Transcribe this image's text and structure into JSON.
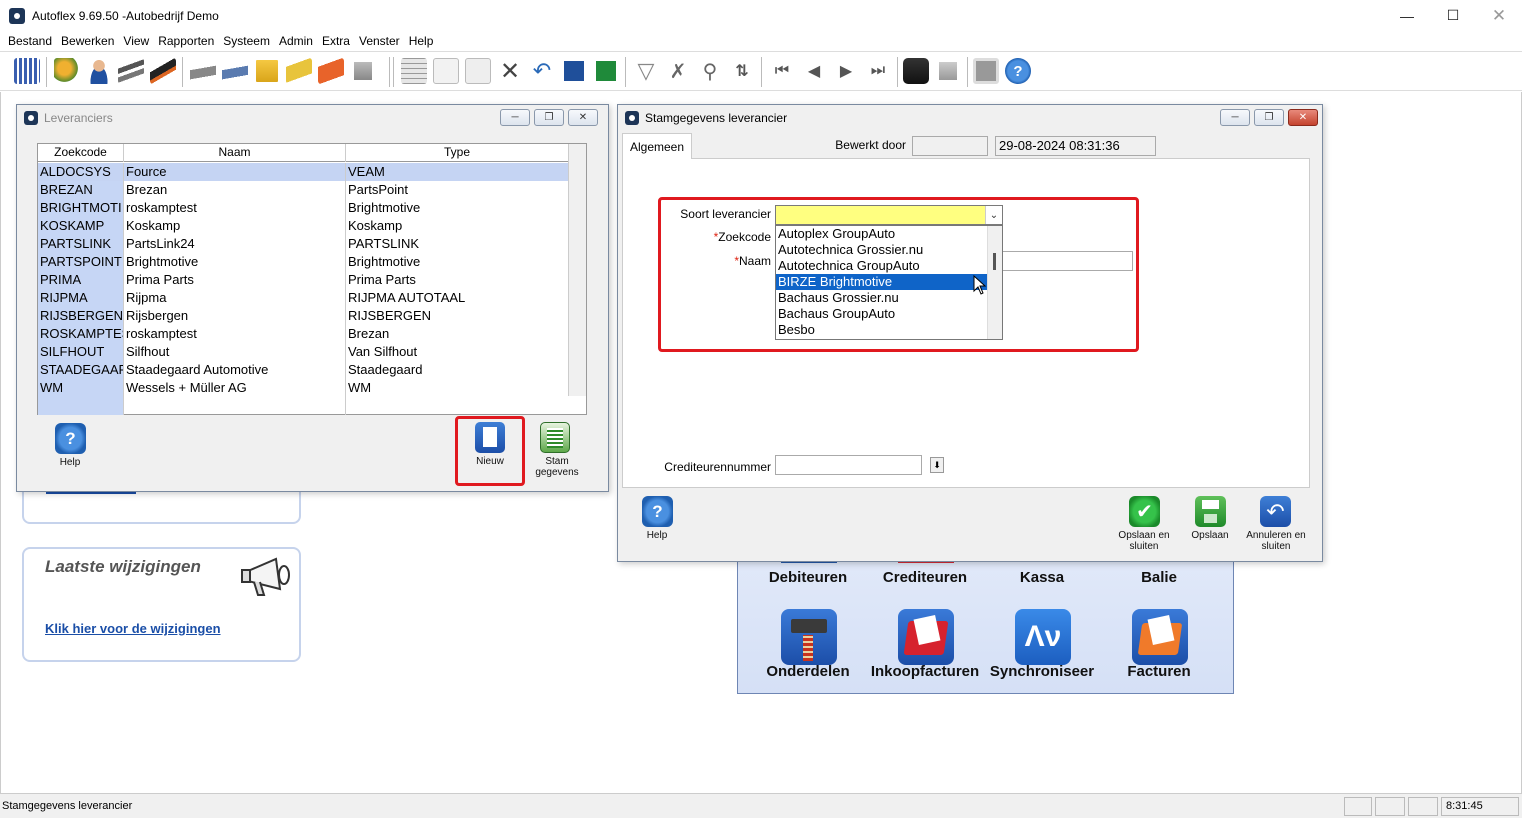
{
  "app": {
    "title": "Autoflex 9.69.50 -Autobedrijf Demo"
  },
  "menu": [
    "Bestand",
    "Bewerken",
    "View",
    "Rapporten",
    "Systeem",
    "Admin",
    "Extra",
    "Venster",
    "Help"
  ],
  "panels": {
    "laatste_title": "Laatste wijzigingen",
    "laatste_link": "Klik hier voor de wijzigingen"
  },
  "dashboard": {
    "labels": [
      "Debiteuren",
      "Crediteuren",
      "Kassa",
      "Balie",
      "Onderdelen",
      "Inkoopfacturen",
      "Synchroniseer",
      "Facturen"
    ]
  },
  "leveranciers": {
    "title": "Leveranciers",
    "columns": [
      "Zoekcode",
      "Naam",
      "Type"
    ],
    "rows": [
      [
        "ALDOCSYS",
        "Fource",
        "VEAM"
      ],
      [
        "BREZAN",
        "Brezan",
        "PartsPoint"
      ],
      [
        "BRIGHTMOTI",
        "roskamptest",
        "Brightmotive"
      ],
      [
        "KOSKAMP",
        "Koskamp",
        "Koskamp"
      ],
      [
        "PARTSLINK",
        "PartsLink24",
        "PARTSLINK"
      ],
      [
        "PARTSPOINT",
        "Brightmotive",
        "Brightmotive"
      ],
      [
        "PRIMA",
        "Prima Parts",
        "Prima Parts"
      ],
      [
        "RIJPMA",
        "Rijpma",
        "RIJPMA AUTOTAAL"
      ],
      [
        "RIJSBERGEN",
        "Rijsbergen",
        "RIJSBERGEN"
      ],
      [
        "ROSKAMPTES",
        "roskamptest",
        "Brezan"
      ],
      [
        "SILFHOUT",
        "Silfhout",
        "Van Silfhout"
      ],
      [
        "STAADEGAAR",
        "Staadegaard Automotive",
        "Staadegaard"
      ],
      [
        "WM",
        "Wessels + Müller AG",
        "WM"
      ]
    ],
    "btn_help": "Help",
    "btn_nieuw": "Nieuw",
    "btn_stam": "Stam gegevens"
  },
  "stam": {
    "title": "Stamgegevens leverancier",
    "tab": "Algemeen",
    "bewerkt_label": "Bewerkt door",
    "bewerkt_value": "",
    "timestamp": "29-08-2024 08:31:36",
    "soort_label": "Soort leverancier",
    "soort_value": "",
    "zoekcode_label": "Zoekcode",
    "naam_label": "Naam",
    "required_mark": "*",
    "dropdown": [
      "Autoplex GroupAuto",
      "Autotechnica Grossier.nu",
      "Autotechnica GroupAuto",
      "BIRZE Brightmotive",
      "Bachaus Grossier.nu",
      "Bachaus GroupAuto",
      "Besbo"
    ],
    "dropdown_selected_index": 3,
    "crediteur_label": "Crediteurennummer",
    "crediteur_value": "",
    "btn_help": "Help",
    "btn_opslaan_sluiten": "Opslaan en sluiten",
    "btn_opslaan": "Opslaan",
    "btn_annuleren": "Annuleren en sluiten"
  },
  "status": {
    "text": "Stamgegevens leverancier",
    "time": "8:31:45"
  },
  "colors": {
    "accent": "#0f64c8",
    "highlight_box": "#e0191f",
    "combo_fill": "#ffff80"
  }
}
